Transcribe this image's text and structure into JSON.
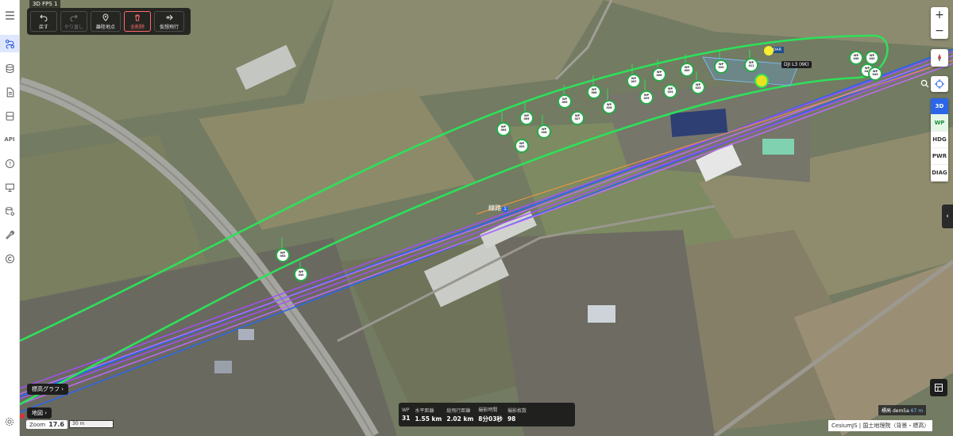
{
  "fps": "3D FPS 1",
  "toolbar": {
    "undo": "戻す",
    "redo": "やり直し",
    "takeoff": "離陸地点",
    "delete_all": "全削除",
    "virtual_flight": "仮想飛行"
  },
  "right_panel": {
    "zoom_in": "+",
    "zoom_out": "−",
    "modes": [
      "3D",
      "WP",
      "HDG",
      "PWR",
      "DIAG"
    ]
  },
  "route_label": "線路",
  "route_number": "1",
  "drone_label": "DJI L3 (6K)",
  "lidar_label": "LIDAR",
  "waypoints": [
    "WP 002",
    "WP 003",
    "WP 004",
    "WP 005",
    "WP 006",
    "WP 007",
    "WP 008",
    "WP 009",
    "WP 010",
    "WP 011",
    "WP 020",
    "WP 021",
    "WP 022",
    "WP 023",
    "WP 024",
    "WP 025",
    "WP 026",
    "WP 027",
    "WP 028",
    "WP 029",
    "WP 030",
    "WP 031",
    "WP 040",
    "WP 041",
    "WP 042",
    "WP 043"
  ],
  "stats": [
    {
      "label": "WP",
      "value": "31"
    },
    {
      "label": "水平距離",
      "value": "1.55 km"
    },
    {
      "label": "総飛行距離",
      "value": "2.02 km"
    },
    {
      "label": "撮影時間",
      "value": "8分03秒"
    },
    {
      "label": "撮影枚数",
      "value": "98"
    }
  ],
  "elev_graph": "標高グラフ",
  "map_label": "地図",
  "zoom_label": "Zoom",
  "zoom_value": "17.6",
  "scale_label": "30 m",
  "elevation": {
    "label": "標高",
    "source": "dem5a",
    "value": "67 m"
  },
  "credits": "CesiumJS | 国土地理院（背景・標高）",
  "colors": {
    "route": "#2ecc40",
    "path": "#a34cff",
    "accent": "#2b66e8"
  }
}
